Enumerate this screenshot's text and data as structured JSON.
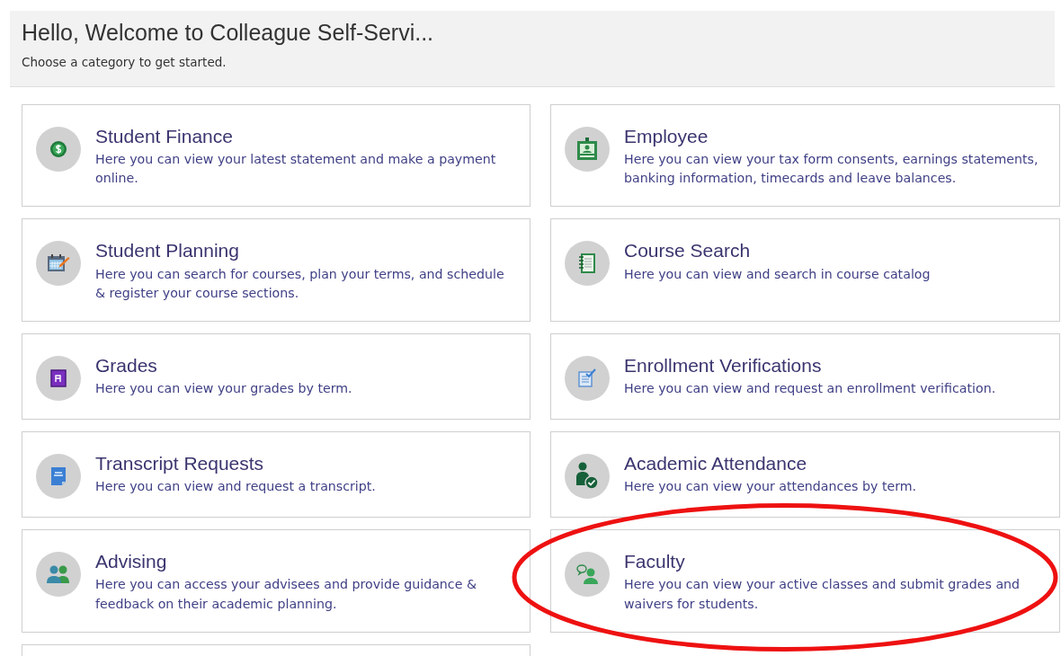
{
  "header": {
    "title": "Hello, Welcome to Colleague Self-Servi...",
    "subtitle": "Choose a category to get started."
  },
  "cards": [
    {
      "kind": "category",
      "title": "Student Finance",
      "description": "Here you can view your latest statement and make a payment online.",
      "highlighted": false
    },
    {
      "kind": "category",
      "title": "Employee",
      "description": "Here you can view your tax form consents, earnings statements, banking information, timecards and leave balances.",
      "highlighted": false
    },
    {
      "kind": "category",
      "title": "Student Planning",
      "description": "Here you can search for courses, plan your terms, and schedule & register your course sections.",
      "highlighted": false
    },
    {
      "kind": "category",
      "title": "Course Search",
      "description": "Here you can view and search in course catalog",
      "highlighted": false
    },
    {
      "kind": "category",
      "title": "Grades",
      "description": "Here you can view your grades by term.",
      "highlighted": false
    },
    {
      "kind": "category",
      "title": "Enrollment Verifications",
      "description": "Here you can view and request an enrollment verification.",
      "highlighted": false
    },
    {
      "kind": "category",
      "title": "Transcript Requests",
      "description": "Here you can view and request a transcript.",
      "highlighted": false
    },
    {
      "kind": "category",
      "title": "Academic Attendance",
      "description": "Here you can view your attendances by term.",
      "highlighted": false
    },
    {
      "kind": "category",
      "title": "Advising",
      "description": "Here you can access your advisees and provide guidance & feedback on their academic planning.",
      "highlighted": false
    },
    {
      "kind": "category",
      "title": "Faculty",
      "description": "Here you can view your active classes and submit grades and waivers for students.",
      "highlighted": true
    },
    {
      "kind": "empty"
    }
  ]
}
